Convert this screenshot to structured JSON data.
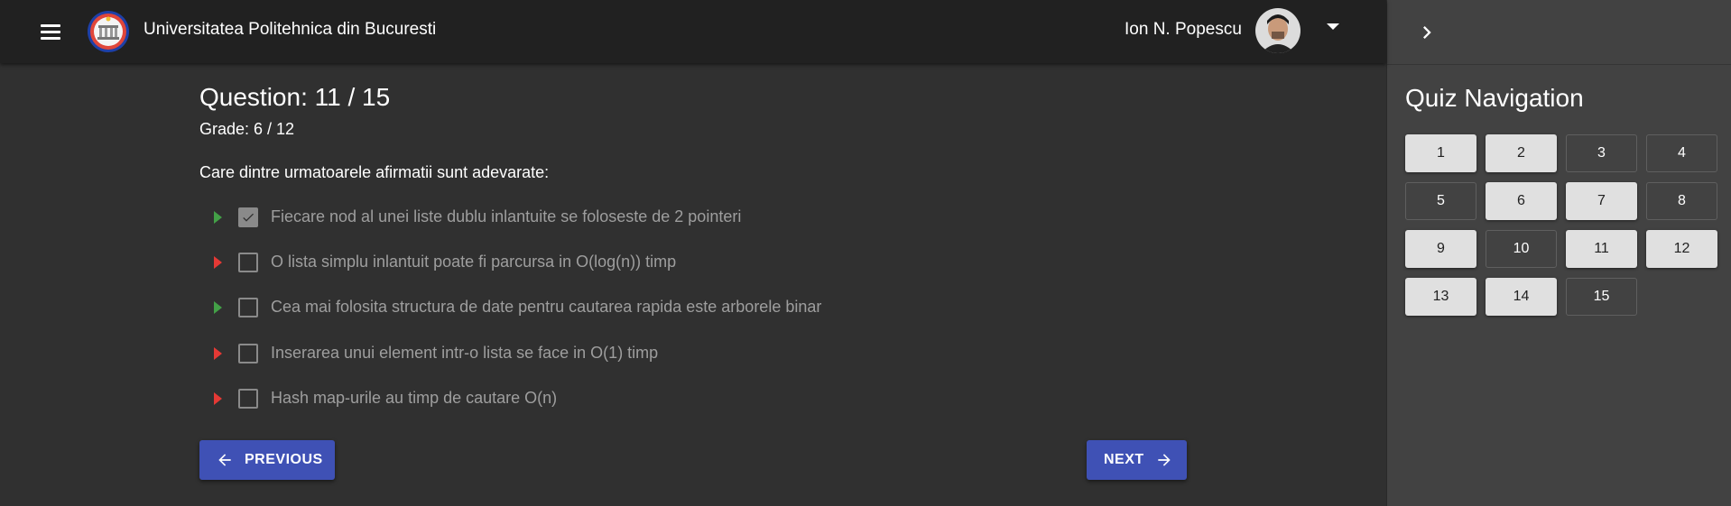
{
  "header": {
    "app_title": "Universitatea Politehnica din Bucuresti",
    "user_name": "Ion N. Popescu"
  },
  "question": {
    "title": "Question: 11 / 15",
    "grade": "Grade: 6 / 12",
    "prompt": "Care dintre urmatoarele afirmatii sunt adevarate:",
    "options": [
      {
        "text": "Fiecare nod al unei liste dublu inlantuite se foloseste de 2 pointeri",
        "checked": true,
        "marker": "correct"
      },
      {
        "text": "O lista simplu inlantuit poate fi parcursa in O(log(n)) timp",
        "checked": false,
        "marker": "wrong"
      },
      {
        "text": "Cea mai folosita structura de date pentru cautarea rapida este arborele binar",
        "checked": false,
        "marker": "correct"
      },
      {
        "text": "Inserarea unui element intr-o lista se face in O(1) timp",
        "checked": false,
        "marker": "wrong"
      },
      {
        "text": "Hash map-urile au timp de cautare O(n)",
        "checked": false,
        "marker": "wrong"
      }
    ]
  },
  "buttons": {
    "previous": "PREVIOUS",
    "next": "NEXT"
  },
  "sidebar": {
    "title": "Quiz Navigation",
    "questions": [
      {
        "label": "1",
        "style": "filled"
      },
      {
        "label": "2",
        "style": "filled"
      },
      {
        "label": "3",
        "style": "outlined"
      },
      {
        "label": "4",
        "style": "outlined"
      },
      {
        "label": "5",
        "style": "outlined"
      },
      {
        "label": "6",
        "style": "filled"
      },
      {
        "label": "7",
        "style": "filled"
      },
      {
        "label": "8",
        "style": "outlined"
      },
      {
        "label": "9",
        "style": "filled"
      },
      {
        "label": "10",
        "style": "outlined"
      },
      {
        "label": "11",
        "style": "filled"
      },
      {
        "label": "12",
        "style": "filled"
      },
      {
        "label": "13",
        "style": "filled"
      },
      {
        "label": "14",
        "style": "filled"
      },
      {
        "label": "15",
        "style": "outlined"
      }
    ]
  },
  "colors": {
    "primary": "#3f51b5",
    "correct_marker": "#43a047",
    "wrong_marker": "#e53935",
    "appbar": "#212121",
    "background": "#303030",
    "sidebar": "#424242"
  },
  "icons": {
    "menu": "menu-icon",
    "logo": "university-crest-logo",
    "dropdown": "arrow-drop-down-icon",
    "previous": "arrow-left-icon",
    "next": "arrow-right-icon",
    "sidebar_toggle": "chevron-right-icon"
  }
}
